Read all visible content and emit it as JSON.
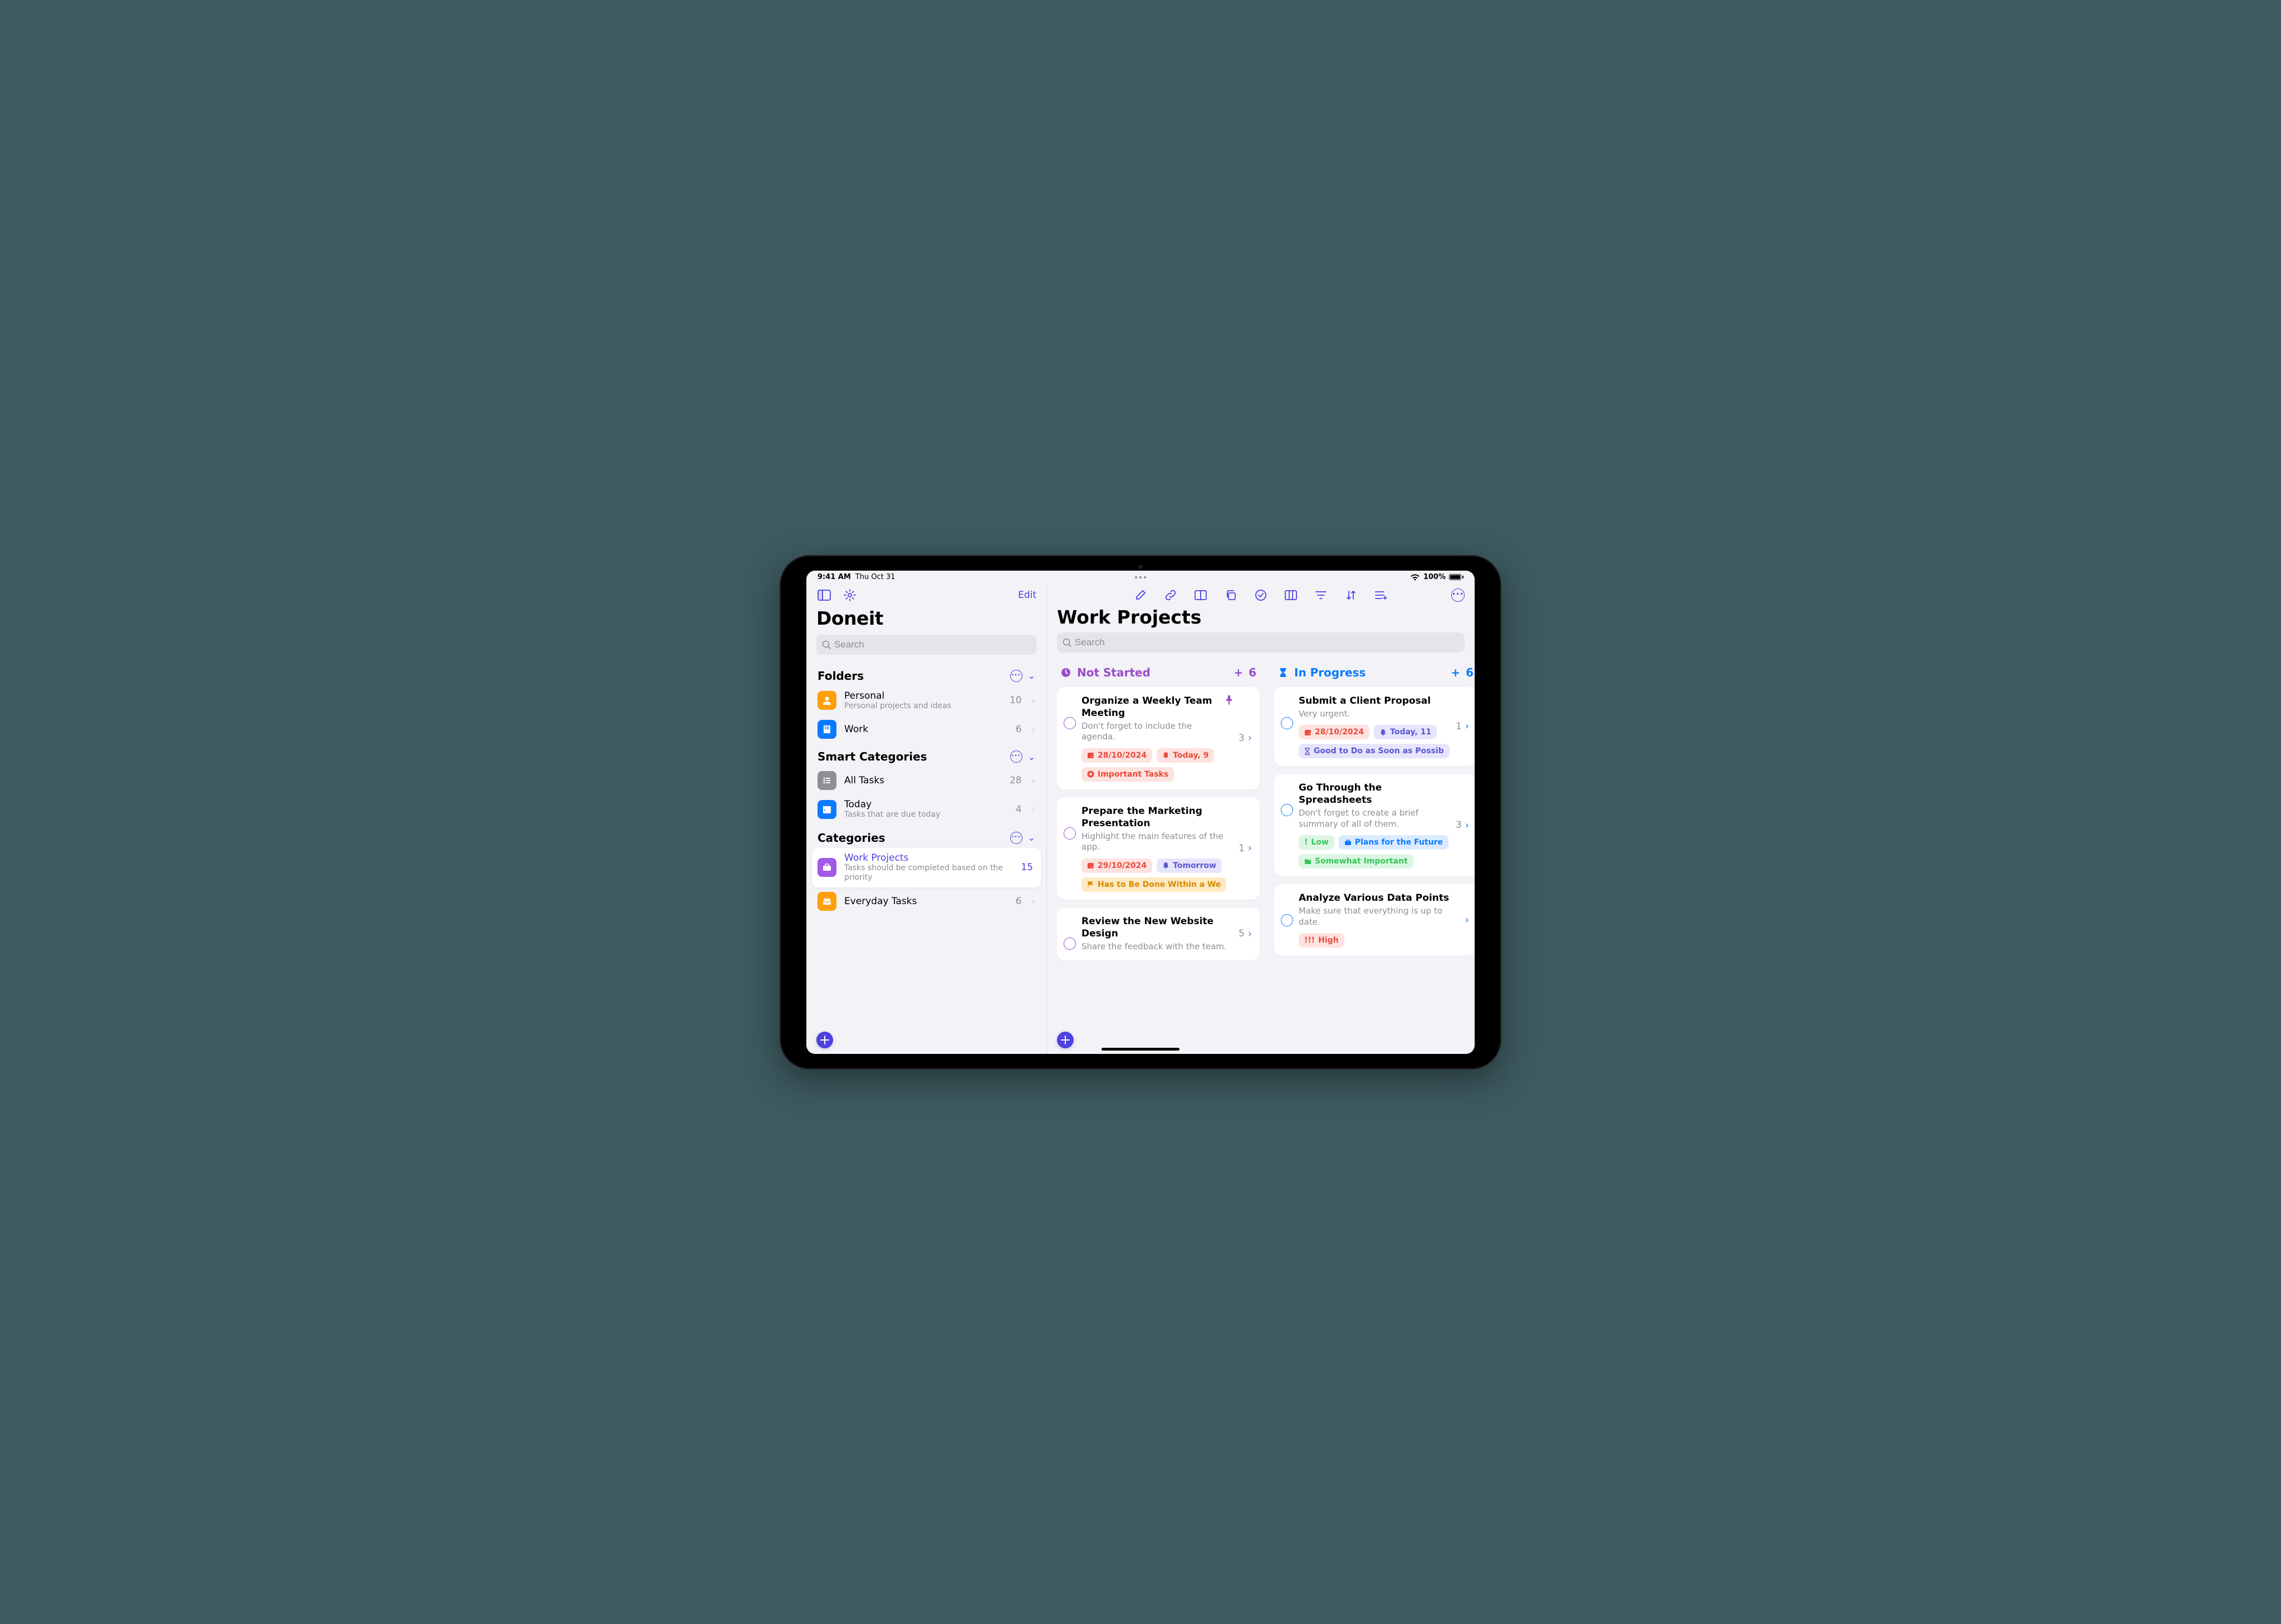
{
  "statusBar": {
    "time": "9:41 AM",
    "date": "Thu Oct 31",
    "wifi": "wifi-icon",
    "batteryPct": "100%"
  },
  "sidebar": {
    "editLabel": "Edit",
    "appName": "Doneit",
    "searchPlaceholder": "Search",
    "sections": {
      "folders": {
        "title": "Folders",
        "items": [
          {
            "title": "Personal",
            "subtitle": "Personal projects and ideas",
            "count": "10",
            "iconBg": "#ff9f0a",
            "icon": "person"
          },
          {
            "title": "Work",
            "subtitle": "",
            "count": "6",
            "iconBg": "#0a7aff",
            "icon": "building"
          }
        ]
      },
      "smart": {
        "title": "Smart Categories",
        "items": [
          {
            "title": "All Tasks",
            "subtitle": "",
            "count": "28",
            "iconBg": "#8e8e93",
            "icon": "list"
          },
          {
            "title": "Today",
            "subtitle": "Tasks that are due today",
            "count": "4",
            "iconBg": "#0a7aff",
            "icon": "calendar"
          }
        ]
      },
      "categories": {
        "title": "Categories",
        "items": [
          {
            "title": "Work Projects",
            "subtitle": "Tasks should be completed based on the priority",
            "count": "15",
            "iconBg": "#a259e6",
            "icon": "briefcase",
            "selected": true
          },
          {
            "title": "Everyday Tasks",
            "subtitle": "",
            "count": "6",
            "iconBg": "#ff9f0a",
            "icon": "tray"
          }
        ]
      }
    }
  },
  "main": {
    "title": "Work Projects",
    "searchPlaceholder": "Search",
    "columns": [
      {
        "id": "not-started",
        "title": "Not Started",
        "color": "#9a4cc8",
        "count": "6",
        "cards": [
          {
            "title": "Organize a Weekly Team Meeting",
            "note": "Don't forget to include the agenda.",
            "pinned": true,
            "count": "3",
            "chips": [
              {
                "icon": "calendar-dot",
                "label": "28/10/2024",
                "fg": "#e74c3c",
                "bg": "#fde2df"
              },
              {
                "icon": "bell",
                "label": "Today, 9",
                "fg": "#e74c3c",
                "bg": "#fde2df"
              },
              {
                "icon": "star-circle",
                "label": "Important Tasks",
                "fg": "#e74c3c",
                "bg": "#fde2df"
              }
            ]
          },
          {
            "title": "Prepare the Marketing Presentation",
            "note": "Highlight the main features of the app.",
            "pinned": false,
            "count": "1",
            "chips": [
              {
                "icon": "calendar-dot",
                "label": "29/10/2024",
                "fg": "#e74c3c",
                "bg": "#fde2df"
              },
              {
                "icon": "bell",
                "label": "Tomorrow",
                "fg": "#5b57d1",
                "bg": "#e6e5fb"
              },
              {
                "icon": "flag",
                "label": "Has to Be Done Within a We",
                "fg": "#d68b00",
                "bg": "#ffe9c2"
              }
            ]
          },
          {
            "title": "Review the New Website Design",
            "note": "Share the feedback with the team.",
            "pinned": false,
            "count": "5",
            "chips": []
          }
        ]
      },
      {
        "id": "in-progress",
        "title": "In Progress",
        "color": "#0a7aff",
        "count": "6",
        "cards": [
          {
            "title": "Submit a Client Proposal",
            "note": "Very urgent.",
            "pinned": false,
            "count": "1",
            "chips": [
              {
                "icon": "calendar-dot",
                "label": "28/10/2024",
                "fg": "#e74c3c",
                "bg": "#fde2df"
              },
              {
                "icon": "bell",
                "label": "Today, 11",
                "fg": "#5b57d1",
                "bg": "#e6e5fb"
              },
              {
                "icon": "hourglass",
                "label": "Good to Do as Soon as Possib",
                "fg": "#5b57d1",
                "bg": "#e6e5fb"
              }
            ]
          },
          {
            "title": "Go Through the Spreadsheets",
            "note": "Don't forget to create a brief summary of all of them.",
            "pinned": false,
            "count": "3",
            "chips": [
              {
                "icon": "priority",
                "label": "Low",
                "fg": "#34c759",
                "bg": "#dcf6e3"
              },
              {
                "icon": "briefcase",
                "label": "Plans for the Future",
                "fg": "#0a7aff",
                "bg": "#dbebff"
              },
              {
                "icon": "folder",
                "label": "Somewhat Important",
                "fg": "#34c759",
                "bg": "#dcf6e3"
              }
            ]
          },
          {
            "title": "Analyze Various Data Points",
            "note": "Make sure that everything is up to date.",
            "pinned": false,
            "count": "",
            "chips": [
              {
                "icon": "priority",
                "label": "High",
                "fg": "#e74c3c",
                "bg": "#fde2df",
                "prefix": "!!!"
              }
            ]
          }
        ]
      }
    ],
    "peekColumn": {
      "color": "#34c759"
    }
  }
}
